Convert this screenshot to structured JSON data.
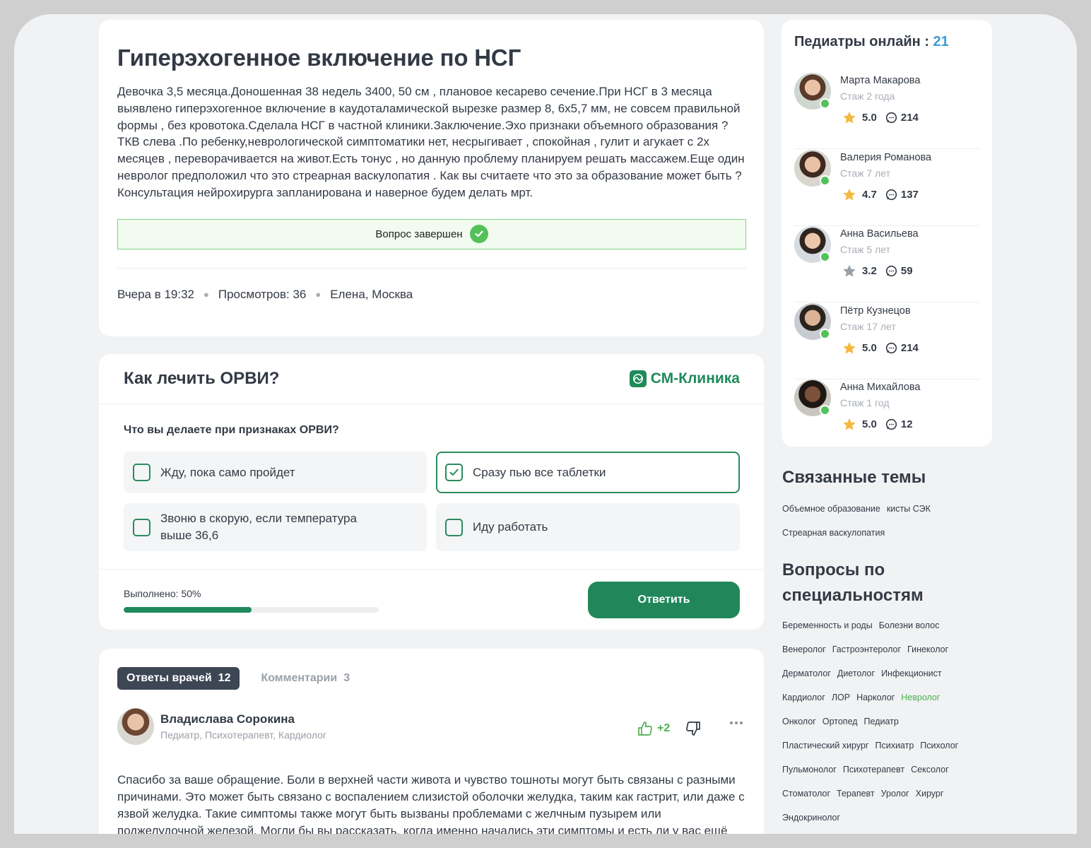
{
  "question": {
    "title": "Гиперэхогенное включение по НСГ",
    "body": "Девочка 3,5 месяца.Доношенная 38 недель 3400, 50 см , плановое кесарево сечение.При НСГ в 3 месяца выявлено гиперэхогенное включение в каудоталамической вырезке размер 8, 6х5,7 мм, не совсем правильной формы , без кровотока.Сделала НСГ в частной клиники.Заключение.Эхо признаки объемного образования ?ТКВ слева .По ребенку,неврологической симптоматики нет, несрыгивает , спокойная , гулит и агукает с 2х месяцев , переворачивается на живот.Есть тонус , но данную проблему планируем решать массажем.Еще один невролог предположил что это стреарная васкулопатия . Как вы считаете что это за образование может быть ?Консультация нейрохирурга запланирована и наверное будем делать мрт.",
    "status": "Вопрос завершен",
    "meta": {
      "time": "Вчера в 19:32",
      "views": "Просмотров: 36",
      "author": "Елена, Москва"
    }
  },
  "poll": {
    "title": "Как лечить ОРВИ?",
    "brand": "СМ-Клиника",
    "brand_color": "#1f8a5b",
    "question": "Что вы делаете при признаках ОРВИ?",
    "options": [
      {
        "label": "Жду, пока само пройдет",
        "checked": false
      },
      {
        "label": "Сразу пью все таблетки",
        "checked": true
      },
      {
        "label": "Звоню в скорую, если температура выше 36,6",
        "checked": false
      },
      {
        "label": "Иду работать",
        "checked": false
      }
    ],
    "progress_label": "Выполнено: 50%",
    "progress": 0.5,
    "submit_label": "Ответить"
  },
  "answers": {
    "tabs": [
      {
        "label": "Ответы врачей",
        "count": "12"
      },
      {
        "label": "Комментарии",
        "count": "3"
      }
    ],
    "first": {
      "author": "Владислава Сорокина",
      "specialties": "Педиатр, Психотерапевт, Кардиолог",
      "likes": "+2",
      "text": "Спасибо за ваше обращение. Боли в верхней части живота и чувство тошноты могут быть связаны с разными причинами. Это может быть связано с воспалением слизистой оболочки желудка, таким как гастрит, или даже с язвой желудка. Такие симптомы также могут быть вызваны проблемами с желчным пузырем или поджелудочной железой. Могли бы вы рассказать, когда именно начались эти симптомы и есть ли у вас ещё какие-то жалобы, например, изжога, горечь во рту, или изменение аппетита?"
    }
  },
  "online": {
    "title": "Педиатры онлайн :",
    "count": "21",
    "doctors": [
      {
        "name": "Марта Макарова",
        "exp": "Стаж 2 года",
        "rating": "5.0",
        "reviews": "214",
        "star_color": "#f4b942"
      },
      {
        "name": "Валерия Романова",
        "exp": "Стаж 7 лет",
        "rating": "4.7",
        "reviews": "137",
        "star_color": "#f4b942"
      },
      {
        "name": "Анна Васильева",
        "exp": "Стаж 5 лет",
        "rating": "3.2",
        "reviews": "59",
        "star_color": "#9aa0a8"
      },
      {
        "name": "Пётр Кузнецов",
        "exp": "Стаж 17 лет",
        "rating": "5.0",
        "reviews": "214",
        "star_color": "#f4b942"
      },
      {
        "name": "Анна Михайлова",
        "exp": "Стаж 1 год",
        "rating": "5.0",
        "reviews": "12",
        "star_color": "#f4b942"
      }
    ]
  },
  "related": {
    "title": "Связанные темы",
    "tags": [
      "Объемное образование",
      "кисты СЭК",
      "Стреарная васкулопатия"
    ]
  },
  "specialties": {
    "title_line1": "Вопросы по",
    "title_line2": "специальностям",
    "tags": [
      "Беременность и роды",
      "Болезни волос",
      "Венеролог",
      "Гастроэнтеролог",
      "Гинеколог",
      "Дерматолог",
      "Диетолог",
      "Инфекционист",
      "Кардиолог",
      "ЛОР",
      "Нарколог",
      "Невролог",
      "Онколог",
      "Ортопед",
      "Педиатр",
      "Пластический хирург",
      "Психиатр",
      "Психолог",
      "Пульмонолог",
      "Психотерапевт",
      "Сексолог",
      "Стоматолог",
      "Терапевт",
      "Уролог",
      "Хирург",
      "Эндокринолог"
    ],
    "highlighted": "Невролог"
  }
}
